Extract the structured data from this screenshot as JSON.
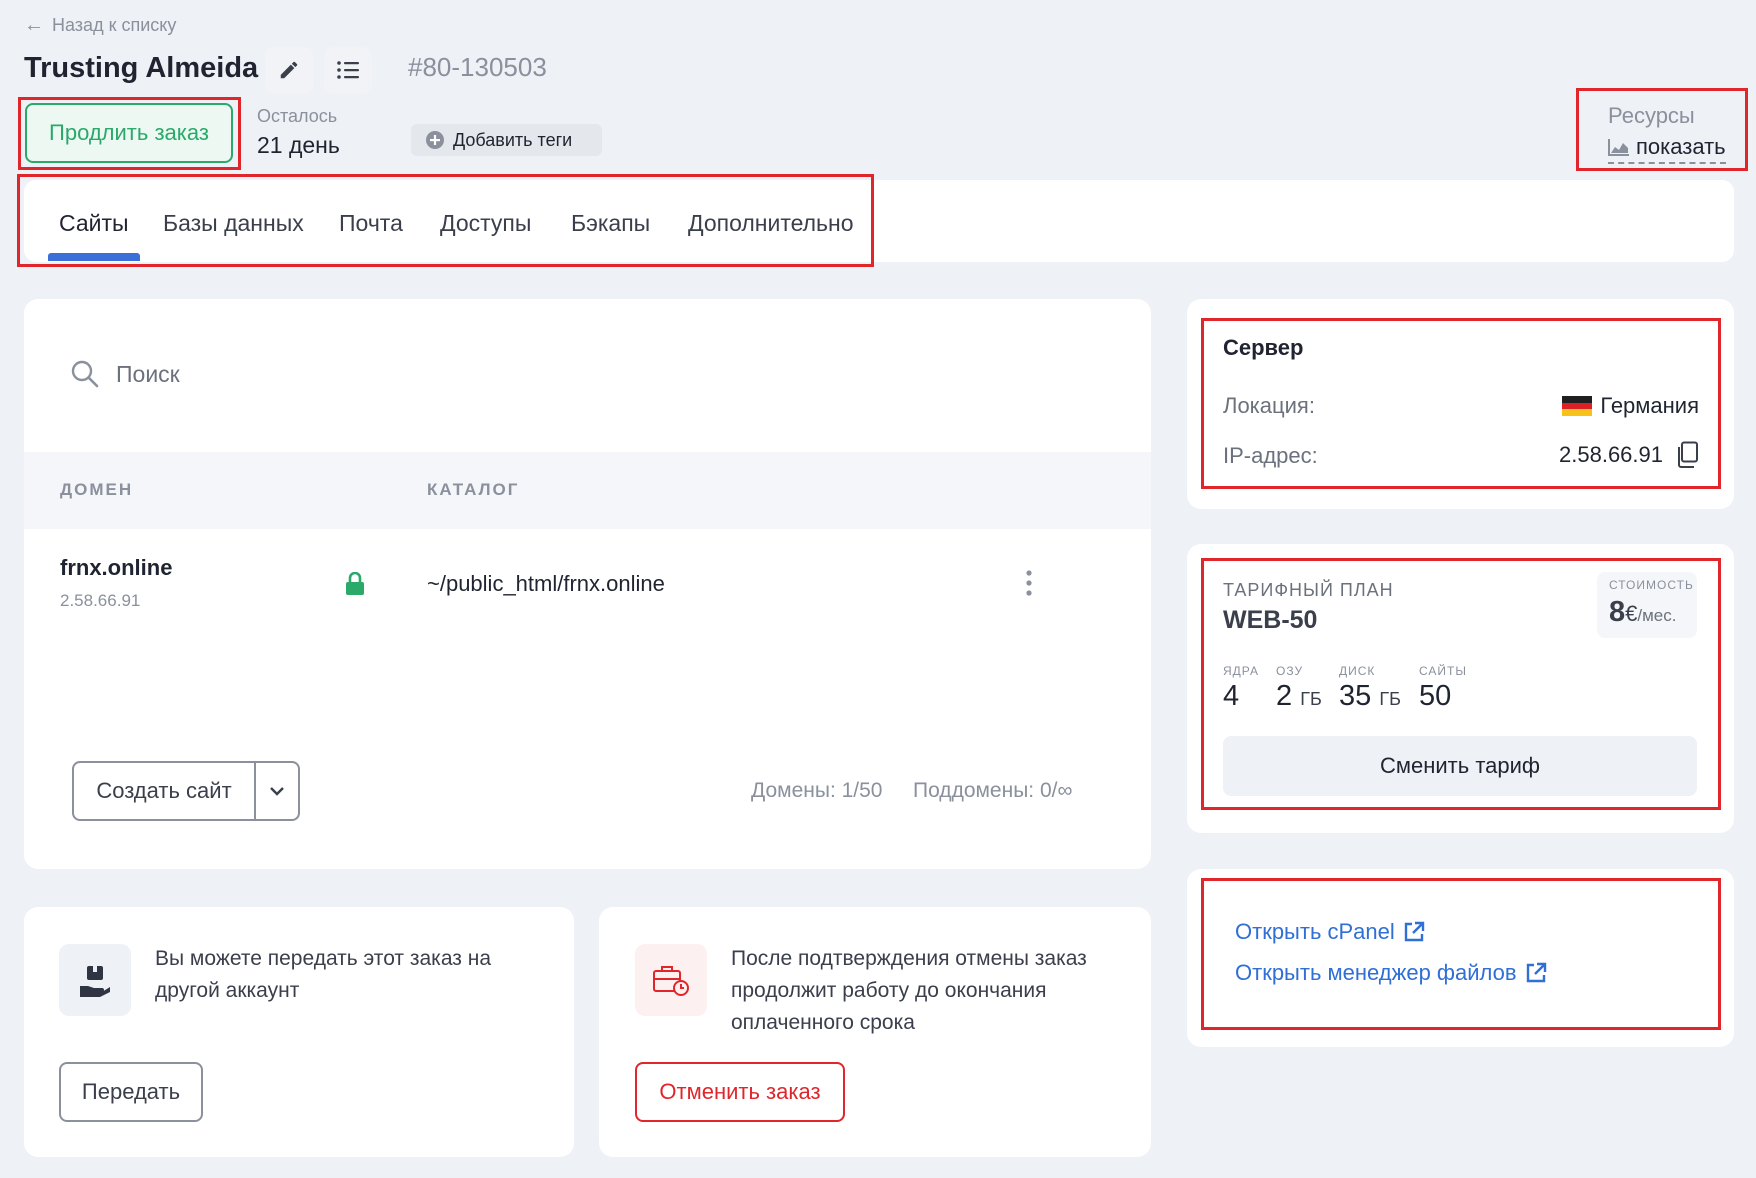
{
  "header": {
    "back_label": "Назад к списку",
    "title": "Trusting Almeida",
    "order_id": "80-130503",
    "order_hash": "#",
    "extend_button": "Продлить заказ",
    "remaining_label": "Осталось",
    "remaining_value": "21 день",
    "add_tags_label": "Добавить теги",
    "resources_label": "Ресурсы",
    "resources_show": "показать"
  },
  "tabs": [
    {
      "label": "Сайты",
      "active": true
    },
    {
      "label": "Базы данных",
      "active": false
    },
    {
      "label": "Почта",
      "active": false
    },
    {
      "label": "Доступы",
      "active": false
    },
    {
      "label": "Бэкапы",
      "active": false
    },
    {
      "label": "Дополнительно",
      "active": false
    }
  ],
  "sites": {
    "search_placeholder": "Поиск",
    "col_domain": "ДОМЕН",
    "col_catalog": "КАТАЛОГ",
    "rows": [
      {
        "domain": "frnx.online",
        "ip": "2.58.66.91",
        "path": "~/public_html/frnx.online"
      }
    ],
    "create_button": "Создать сайт",
    "domains_count": "Домены: 1/50",
    "subdomains_count": "Поддомены: 0/∞"
  },
  "transfer": {
    "text": "Вы можете передать этот заказ на другой аккаунт",
    "button": "Передать"
  },
  "cancel": {
    "text": "После подтверждения отмены заказ продолжит работу до окончания оплаченного срока",
    "button": "Отменить заказ"
  },
  "server": {
    "title": "Сервер",
    "location_label": "Локация:",
    "location_value": "Германия",
    "ip_label": "IP-адрес:",
    "ip_value": "2.58.66.91"
  },
  "plan": {
    "label": "ТАРИФНЫЙ ПЛАН",
    "name": "WEB-50",
    "cost_label": "СТОИМОСТЬ",
    "cost_value": "8",
    "cost_unit": "€",
    "cost_period": "/мес.",
    "specs": [
      {
        "label": "ЯДРА",
        "value": "4",
        "unit": ""
      },
      {
        "label": "ОЗУ",
        "value": "2",
        "unit": "ГБ"
      },
      {
        "label": "ДИСК",
        "value": "35",
        "unit": "ГБ"
      },
      {
        "label": "САЙТЫ",
        "value": "50",
        "unit": ""
      }
    ],
    "change_button": "Сменить тариф"
  },
  "links": {
    "cpanel": "Открыть cPanel",
    "file_manager": "Открыть менеджер файлов"
  },
  "colors": {
    "accent_green": "#2aa96b",
    "accent_blue": "#2f6fd6",
    "danger_red": "#e0262b",
    "tab_indicator": "#3b6fd8"
  }
}
